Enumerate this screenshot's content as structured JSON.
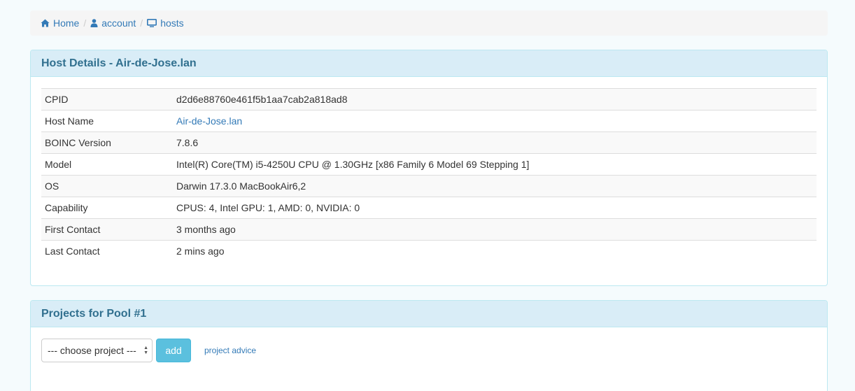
{
  "breadcrumb": {
    "items": [
      {
        "label": "Home",
        "icon": "home-icon"
      },
      {
        "label": "account",
        "icon": "user-icon"
      },
      {
        "label": "hosts",
        "icon": "monitor-icon"
      }
    ],
    "separator": "/"
  },
  "host_panel": {
    "title": "Host Details - Air-de-Jose.lan",
    "rows": [
      {
        "label": "CPID",
        "value": "d2d6e88760e461f5b1aa7cab2a818ad8"
      },
      {
        "label": "Host Name",
        "value": "Air-de-Jose.lan"
      },
      {
        "label": "BOINC Version",
        "value": "7.8.6"
      },
      {
        "label": "Model",
        "value": "Intel(R) Core(TM) i5-4250U CPU @ 1.30GHz [x86 Family 6 Model 69 Stepping 1]"
      },
      {
        "label": "OS",
        "value": "Darwin 17.3.0 MacBookAir6,2"
      },
      {
        "label": "Capability",
        "value": "CPUS: 4, Intel GPU: 1, AMD: 0, NVIDIA: 0"
      },
      {
        "label": "First Contact",
        "value": "3 months ago"
      },
      {
        "label": "Last Contact",
        "value": "2 mins ago"
      }
    ]
  },
  "projects_panel": {
    "title": "Projects for Pool #1",
    "select_value": "--- choose project ---",
    "add_label": "add",
    "advice_label": "project advice"
  },
  "colors": {
    "link": "#337ab7",
    "panel_heading_bg": "#d9edf7",
    "panel_heading_text": "#31708f",
    "info_button": "#5bc0de"
  }
}
